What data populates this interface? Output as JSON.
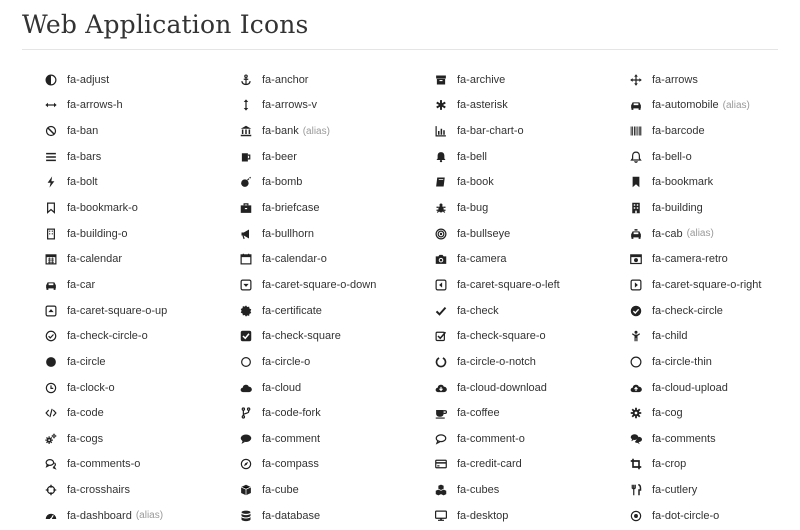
{
  "page": {
    "title": "Web Application Icons"
  },
  "icons": [
    {
      "name": "adjust",
      "label": "fa-adjust",
      "alias": ""
    },
    {
      "name": "anchor",
      "label": "fa-anchor",
      "alias": ""
    },
    {
      "name": "archive",
      "label": "fa-archive",
      "alias": ""
    },
    {
      "name": "arrows",
      "label": "fa-arrows",
      "alias": ""
    },
    {
      "name": "arrows-h",
      "label": "fa-arrows-h",
      "alias": ""
    },
    {
      "name": "arrows-v",
      "label": "fa-arrows-v",
      "alias": ""
    },
    {
      "name": "asterisk",
      "label": "fa-asterisk",
      "alias": ""
    },
    {
      "name": "automobile",
      "label": "fa-automobile",
      "alias": "(alias)"
    },
    {
      "name": "ban",
      "label": "fa-ban",
      "alias": ""
    },
    {
      "name": "bank",
      "label": "fa-bank",
      "alias": "(alias)"
    },
    {
      "name": "bar-chart-o",
      "label": "fa-bar-chart-o",
      "alias": ""
    },
    {
      "name": "barcode",
      "label": "fa-barcode",
      "alias": ""
    },
    {
      "name": "bars",
      "label": "fa-bars",
      "alias": ""
    },
    {
      "name": "beer",
      "label": "fa-beer",
      "alias": ""
    },
    {
      "name": "bell",
      "label": "fa-bell",
      "alias": ""
    },
    {
      "name": "bell-o",
      "label": "fa-bell-o",
      "alias": ""
    },
    {
      "name": "bolt",
      "label": "fa-bolt",
      "alias": ""
    },
    {
      "name": "bomb",
      "label": "fa-bomb",
      "alias": ""
    },
    {
      "name": "book",
      "label": "fa-book",
      "alias": ""
    },
    {
      "name": "bookmark",
      "label": "fa-bookmark",
      "alias": ""
    },
    {
      "name": "bookmark-o",
      "label": "fa-bookmark-o",
      "alias": ""
    },
    {
      "name": "briefcase",
      "label": "fa-briefcase",
      "alias": ""
    },
    {
      "name": "bug",
      "label": "fa-bug",
      "alias": ""
    },
    {
      "name": "building",
      "label": "fa-building",
      "alias": ""
    },
    {
      "name": "building-o",
      "label": "fa-building-o",
      "alias": ""
    },
    {
      "name": "bullhorn",
      "label": "fa-bullhorn",
      "alias": ""
    },
    {
      "name": "bullseye",
      "label": "fa-bullseye",
      "alias": ""
    },
    {
      "name": "cab",
      "label": "fa-cab",
      "alias": "(alias)"
    },
    {
      "name": "calendar",
      "label": "fa-calendar",
      "alias": ""
    },
    {
      "name": "calendar-o",
      "label": "fa-calendar-o",
      "alias": ""
    },
    {
      "name": "camera",
      "label": "fa-camera",
      "alias": ""
    },
    {
      "name": "camera-retro",
      "label": "fa-camera-retro",
      "alias": ""
    },
    {
      "name": "car",
      "label": "fa-car",
      "alias": ""
    },
    {
      "name": "caret-square-o-down",
      "label": "fa-caret-square-o-down",
      "alias": ""
    },
    {
      "name": "caret-square-o-left",
      "label": "fa-caret-square-o-left",
      "alias": ""
    },
    {
      "name": "caret-square-o-right",
      "label": "fa-caret-square-o-right",
      "alias": ""
    },
    {
      "name": "caret-square-o-up",
      "label": "fa-caret-square-o-up",
      "alias": ""
    },
    {
      "name": "certificate",
      "label": "fa-certificate",
      "alias": ""
    },
    {
      "name": "check",
      "label": "fa-check",
      "alias": ""
    },
    {
      "name": "check-circle",
      "label": "fa-check-circle",
      "alias": ""
    },
    {
      "name": "check-circle-o",
      "label": "fa-check-circle-o",
      "alias": ""
    },
    {
      "name": "check-square",
      "label": "fa-check-square",
      "alias": ""
    },
    {
      "name": "check-square-o",
      "label": "fa-check-square-o",
      "alias": ""
    },
    {
      "name": "child",
      "label": "fa-child",
      "alias": ""
    },
    {
      "name": "circle",
      "label": "fa-circle",
      "alias": ""
    },
    {
      "name": "circle-o",
      "label": "fa-circle-o",
      "alias": ""
    },
    {
      "name": "circle-o-notch",
      "label": "fa-circle-o-notch",
      "alias": ""
    },
    {
      "name": "circle-thin",
      "label": "fa-circle-thin",
      "alias": ""
    },
    {
      "name": "clock-o",
      "label": "fa-clock-o",
      "alias": ""
    },
    {
      "name": "cloud",
      "label": "fa-cloud",
      "alias": ""
    },
    {
      "name": "cloud-download",
      "label": "fa-cloud-download",
      "alias": ""
    },
    {
      "name": "cloud-upload",
      "label": "fa-cloud-upload",
      "alias": ""
    },
    {
      "name": "code",
      "label": "fa-code",
      "alias": ""
    },
    {
      "name": "code-fork",
      "label": "fa-code-fork",
      "alias": ""
    },
    {
      "name": "coffee",
      "label": "fa-coffee",
      "alias": ""
    },
    {
      "name": "cog",
      "label": "fa-cog",
      "alias": ""
    },
    {
      "name": "cogs",
      "label": "fa-cogs",
      "alias": ""
    },
    {
      "name": "comment",
      "label": "fa-comment",
      "alias": ""
    },
    {
      "name": "comment-o",
      "label": "fa-comment-o",
      "alias": ""
    },
    {
      "name": "comments",
      "label": "fa-comments",
      "alias": ""
    },
    {
      "name": "comments-o",
      "label": "fa-comments-o",
      "alias": ""
    },
    {
      "name": "compass",
      "label": "fa-compass",
      "alias": ""
    },
    {
      "name": "credit-card",
      "label": "fa-credit-card",
      "alias": ""
    },
    {
      "name": "crop",
      "label": "fa-crop",
      "alias": ""
    },
    {
      "name": "crosshairs",
      "label": "fa-crosshairs",
      "alias": ""
    },
    {
      "name": "cube",
      "label": "fa-cube",
      "alias": ""
    },
    {
      "name": "cubes",
      "label": "fa-cubes",
      "alias": ""
    },
    {
      "name": "cutlery",
      "label": "fa-cutlery",
      "alias": ""
    },
    {
      "name": "dashboard",
      "label": "fa-dashboard",
      "alias": "(alias)"
    },
    {
      "name": "database",
      "label": "fa-database",
      "alias": ""
    },
    {
      "name": "desktop",
      "label": "fa-desktop",
      "alias": ""
    },
    {
      "name": "dot-circle-o",
      "label": "fa-dot-circle-o",
      "alias": ""
    }
  ]
}
